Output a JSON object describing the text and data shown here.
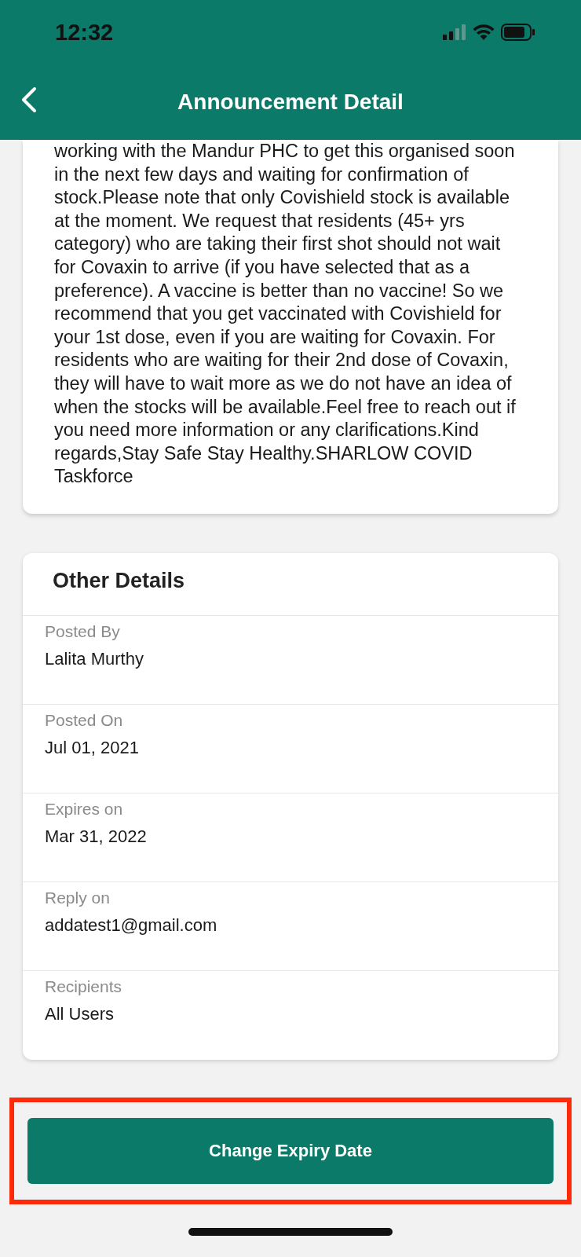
{
  "status_bar": {
    "time": "12:32"
  },
  "header": {
    "title": "Announcement Detail"
  },
  "announcement": {
    "body": "working with the Mandur PHC to get this organised soon in the next few days and waiting for confirmation of stock.Please note that only Covishield stock is available at the moment. We request that residents (45+ yrs category) who are taking their first shot should not wait for Covaxin to arrive (if you have selected that as a preference). A vaccine is better than no vaccine! So we recommend that you get vaccinated with Covishield for your 1st dose, even if you are waiting for Covaxin. For residents who are waiting for their 2nd dose of Covaxin, they will have to wait more as we do not have an idea of when the stocks will be available.Feel free to reach out if you need more information or any clarifications.Kind regards,Stay Safe Stay Healthy.SHARLOW COVID Taskforce"
  },
  "other_details": {
    "title": "Other Details",
    "rows": [
      {
        "label": "Posted By",
        "value": "Lalita Murthy"
      },
      {
        "label": "Posted On",
        "value": "Jul 01, 2021"
      },
      {
        "label": "Expires on",
        "value": "Mar 31, 2022"
      },
      {
        "label": "Reply on",
        "value": "addatest1@gmail.com"
      },
      {
        "label": "Recipients",
        "value": "All Users"
      }
    ]
  },
  "action_button": {
    "label": "Change Expiry Date",
    "highlighted": true
  }
}
